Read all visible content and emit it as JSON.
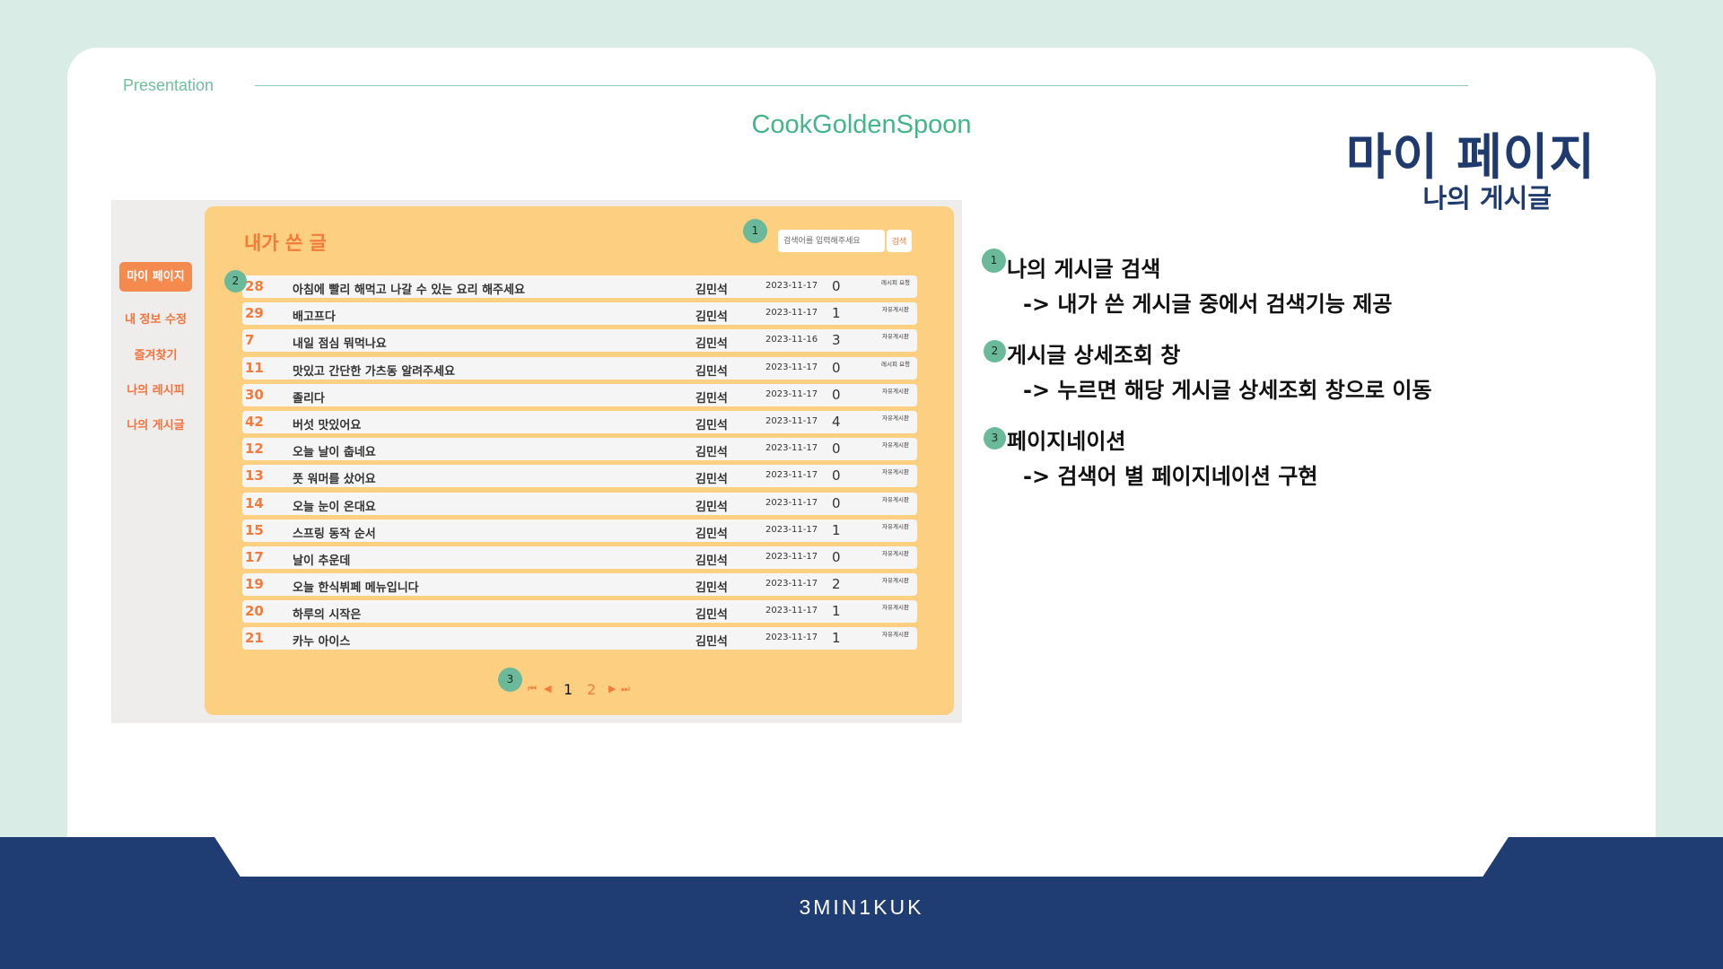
{
  "slide": {
    "label": "Presentation",
    "project": "CookGoldenSpoon",
    "title": "마이 페이지",
    "subtitle": "나의 게시글",
    "footer": "3MIN1KUK"
  },
  "screenshot": {
    "sidebar": [
      "마이 페이지",
      "내 정보 수정",
      "즐겨찾기",
      "나의 레시피",
      "나의 게시글"
    ],
    "panel_title": "내가 쓴 글",
    "search": {
      "placeholder": "검색어를 입력해주세요",
      "button": "검색"
    },
    "rows": [
      {
        "num": "28",
        "title": "아침에 빨리 해먹고 나갈 수 있는 요리 해주세요",
        "author": "김민석",
        "date": "2023-11-17",
        "count": "0",
        "category": "레시피 요청"
      },
      {
        "num": "29",
        "title": "배고프다",
        "author": "김민석",
        "date": "2023-11-17",
        "count": "1",
        "category": "자유게시판"
      },
      {
        "num": "7",
        "title": "내일 점심 뭐먹나요",
        "author": "김민석",
        "date": "2023-11-16",
        "count": "3",
        "category": "자유게시판"
      },
      {
        "num": "11",
        "title": "맛있고 간단한 가츠동 알려주세요",
        "author": "김민석",
        "date": "2023-11-17",
        "count": "0",
        "category": "레시피 요청"
      },
      {
        "num": "30",
        "title": "졸리다",
        "author": "김민석",
        "date": "2023-11-17",
        "count": "0",
        "category": "자유게시판"
      },
      {
        "num": "42",
        "title": "버섯 맛있어요",
        "author": "김민석",
        "date": "2023-11-17",
        "count": "4",
        "category": "자유게시판"
      },
      {
        "num": "12",
        "title": "오늘 날이 춥네요",
        "author": "김민석",
        "date": "2023-11-17",
        "count": "0",
        "category": "자유게시판"
      },
      {
        "num": "13",
        "title": "풋 워머를 샀어요",
        "author": "김민석",
        "date": "2023-11-17",
        "count": "0",
        "category": "자유게시판"
      },
      {
        "num": "14",
        "title": "오늘 눈이 온대요",
        "author": "김민석",
        "date": "2023-11-17",
        "count": "0",
        "category": "자유게시판"
      },
      {
        "num": "15",
        "title": "스프링 동작 순서",
        "author": "김민석",
        "date": "2023-11-17",
        "count": "1",
        "category": "자유게시판"
      },
      {
        "num": "17",
        "title": "날이 추운데",
        "author": "김민석",
        "date": "2023-11-17",
        "count": "0",
        "category": "자유게시판"
      },
      {
        "num": "19",
        "title": "오늘 한식뷔페 메뉴입니다",
        "author": "김민석",
        "date": "2023-11-17",
        "count": "2",
        "category": "자유게시판"
      },
      {
        "num": "20",
        "title": "하루의 시작은",
        "author": "김민석",
        "date": "2023-11-17",
        "count": "1",
        "category": "자유게시판"
      },
      {
        "num": "21",
        "title": "카누 아이스",
        "author": "김민석",
        "date": "2023-11-17",
        "count": "1",
        "category": "자유게시판"
      }
    ],
    "pagination": {
      "first": "⏮",
      "prev": "◀",
      "pages": [
        "1",
        "2"
      ],
      "current": "1",
      "next": "▶",
      "last": "⏭"
    }
  },
  "markers": [
    "1",
    "2",
    "3"
  ],
  "descriptions": [
    {
      "marker": "1",
      "head": "나의 게시글 검색",
      "body": "-> 내가 쓴 게시글 중에서 검색기능 제공"
    },
    {
      "marker": "2",
      "head": "게시글 상세조회 창",
      "body": "-> 누르면 해당 게시글 상세조회 창으로 이동"
    },
    {
      "marker": "3",
      "head": "페이지네이션",
      "body": "-> 검색어 별 페이지네이션 구현"
    }
  ],
  "colors": {
    "background": "#d9ede6",
    "accent_green": "#44b58a",
    "navy": "#1f3c73",
    "panel_yellow": "#fdd081",
    "orange": "#f47a3a"
  }
}
